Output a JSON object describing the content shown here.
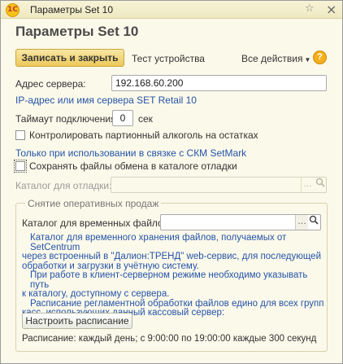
{
  "window": {
    "title": "Параметры Set 10",
    "logo_text": "1С",
    "star_icon": "star-icon",
    "close_icon": "close-icon"
  },
  "header": {
    "title": "Параметры Set 10"
  },
  "toolbar": {
    "save_close_label": "Записать и закрыть",
    "test_label": "Тест устройства",
    "all_actions_label": "Все действия",
    "help_label": "?"
  },
  "server": {
    "label": "Адрес сервера:",
    "value": "192.168.60.200",
    "hint": "IP-адрес или имя сервера SET Retail 10"
  },
  "timeout": {
    "label": "Таймаут подключения:",
    "value": "0",
    "unit": "сек"
  },
  "alcohol": {
    "checkbox_label": "Контролировать партионный алкоголь на остатках",
    "checked": false,
    "hint": "Только при использовании в связке с СКМ SetMark"
  },
  "debug": {
    "checkbox_label": "Сохранять файлы обмена в каталоге отладки",
    "checked": false,
    "catalog_label": "Каталог для отладки:",
    "catalog_value": ""
  },
  "online_sales": {
    "group_title": "Снятие оперативных продаж",
    "temp_catalog_label": "Каталог для временных файлов:",
    "temp_catalog_value": "",
    "description": [
      "Каталог для временного хранения файлов, получаемых от SetCentrum",
      "через встроенный в \"Далион:ТРЕНД\" web-сервис, для последующей",
      "обработки и загрузки в учётную систему.",
      "При работе в клиент-серверном режиме необходимо указывать путь",
      "к каталогу, доступному с сервера.",
      "Расписание регламентной обработки файлов едино для всех групп",
      "касс, использующих данный кассовый сервер:"
    ],
    "schedule_button_label": "Настроить расписание",
    "schedule_text": "Расписание: каждый день; с 9:00:00 по 19:00:00 каждые 300 секунд"
  },
  "colors": {
    "accent": "#ecc95b",
    "link_blue": "#2453a8",
    "background": "#fbf9ea"
  }
}
